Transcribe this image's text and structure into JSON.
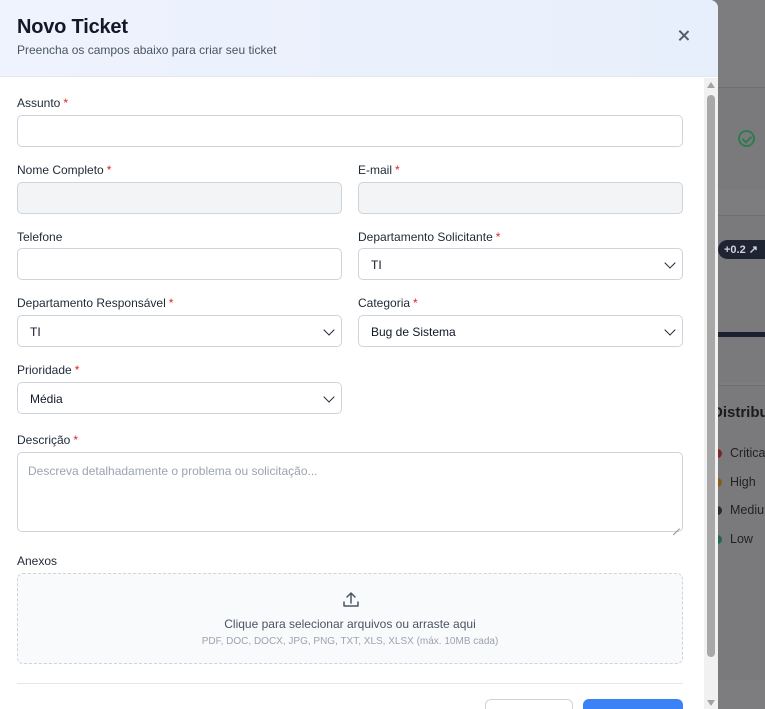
{
  "modal": {
    "title": "Novo Ticket",
    "subtitle": "Preencha os campos abaixo para criar seu ticket",
    "required_marker": "*"
  },
  "form": {
    "assunto": {
      "label": "Assunto",
      "value": ""
    },
    "nome": {
      "label": "Nome Completo",
      "value": ""
    },
    "email": {
      "label": "E-mail",
      "value": ""
    },
    "telefone": {
      "label": "Telefone",
      "value": ""
    },
    "dep_solicitante": {
      "label": "Departamento Solicitante",
      "value": "TI"
    },
    "dep_responsavel": {
      "label": "Departamento Responsável",
      "value": "TI"
    },
    "categoria": {
      "label": "Categoria",
      "value": "Bug de Sistema"
    },
    "prioridade": {
      "label": "Prioridade",
      "value": "Média"
    },
    "descricao": {
      "label": "Descrição",
      "placeholder": "Descreva detalhadamente o problema ou solicitação..."
    },
    "anexos": {
      "label": "Anexos",
      "dropzone_text": "Clique para selecionar arquivos ou arraste aqui",
      "dropzone_hint": "PDF, DOC, DOCX, JPG, PNG, TXT, XLS, XLSX (máx. 10MB cada)"
    }
  },
  "background": {
    "badge": "+0.2",
    "section_title": "Distribu",
    "legend": [
      {
        "label": "Critica",
        "color": "#7a2626"
      },
      {
        "label": "High",
        "color": "#8a5a1a"
      },
      {
        "label": "Mediu",
        "color": "#2a2a2a"
      },
      {
        "label": "Low",
        "color": "#1f6a45"
      }
    ]
  },
  "colors": {
    "accent": "#3b82f6",
    "required": "#dc2626",
    "header_bg": "#eef3fd"
  }
}
